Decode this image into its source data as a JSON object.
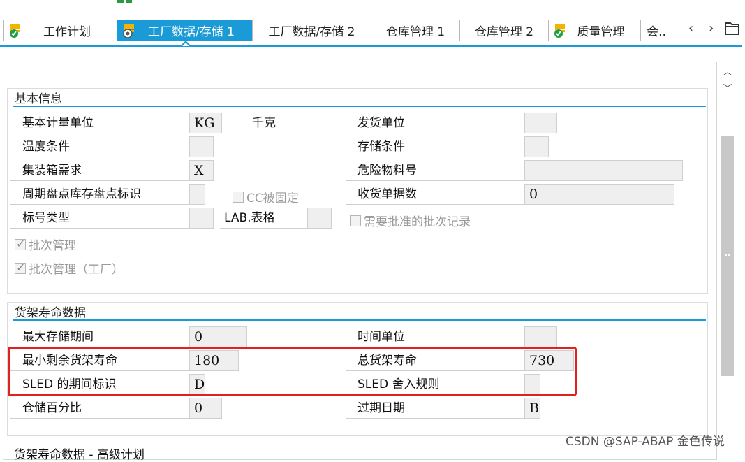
{
  "tabs": [
    {
      "label": "工作计划",
      "icon": "status-ok-icon"
    },
    {
      "label": "工厂数据/存储 1",
      "icon": "status-active-icon"
    },
    {
      "label": "工厂数据/存储 2"
    },
    {
      "label": "仓库管理 1"
    },
    {
      "label": "仓库管理 2"
    },
    {
      "label": "质量管理",
      "icon": "status-ok-icon"
    },
    {
      "label": "会.."
    }
  ],
  "nav": {
    "prev": "‹",
    "next": "›"
  },
  "basic": {
    "title": "基本信息",
    "base_uom_label": "基本计量单位",
    "base_uom_value": "KG",
    "base_uom_text": "千克",
    "issue_unit_label": "发货单位",
    "issue_unit_value": "",
    "temp_cond_label": "温度条件",
    "temp_cond_value": "",
    "storage_cond_label": "存储条件",
    "storage_cond_value": "",
    "container_label": "集装箱需求",
    "container_value": "X",
    "hazmat_label": "危险物料号",
    "hazmat_value": "",
    "cycle_count_label": "周期盘点库存盘点标识",
    "cycle_count_value": "",
    "cc_fixed_label": "CC被固定",
    "gr_slips_label": "收货单据数",
    "gr_slips_value": "0",
    "label_type_label": "标号类型",
    "label_type_value": "",
    "lab_form_label": "LAB.表格",
    "lab_form_value": "",
    "approved_batch_label": "需要批准的批次记录",
    "batch_mgmt_label": "批次管理",
    "batch_mgmt_plant_label": "批次管理（工厂）"
  },
  "shelf": {
    "title": "货架寿命数据",
    "max_storage_label": "最大存储期间",
    "max_storage_value": "0",
    "time_unit_label": "时间单位",
    "time_unit_value": "",
    "min_rem_label": "最小剩余货架寿命",
    "min_rem_value": "180",
    "total_shelf_label": "总货架寿命",
    "total_shelf_value": "730",
    "sled_period_label": "SLED 的期间标识",
    "sled_period_value": "D",
    "sled_round_label": "SLED 舍入规则",
    "sled_round_value": "",
    "storage_pct_label": "仓储百分比",
    "storage_pct_value": "0",
    "expiry_label": "过期日期",
    "expiry_value": "B"
  },
  "next_section_title": "货架寿命数据 - 高级计划",
  "watermark": "CSDN @SAP-ABAP 金色传说",
  "colors": {
    "accent": "#1a9bd7",
    "highlight": "#e0211c"
  }
}
